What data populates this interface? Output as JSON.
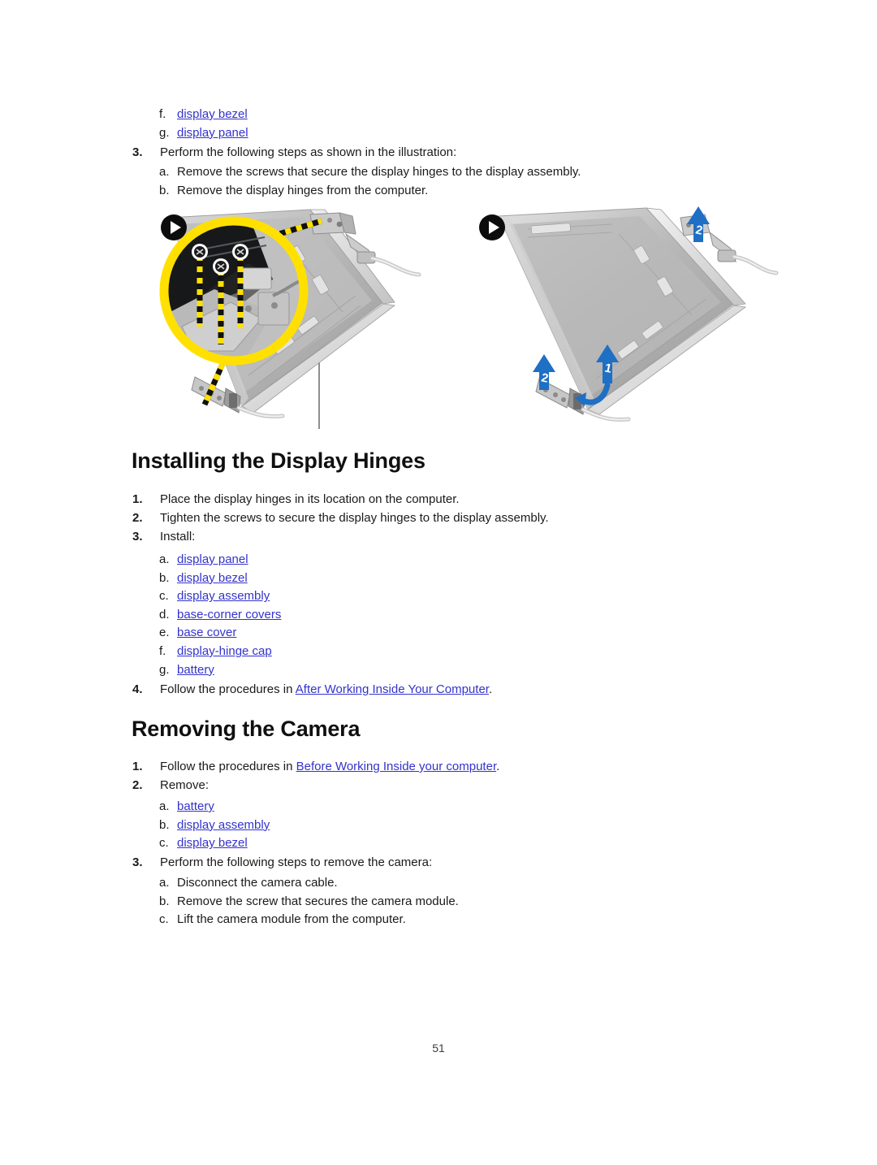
{
  "page": {
    "number": "51",
    "link_color": "#3333cc",
    "text_color": "#1a1a1a"
  },
  "continued_list": {
    "items": [
      {
        "marker": "f.",
        "label": "display bezel",
        "is_link": true
      },
      {
        "marker": "g.",
        "label": "display panel",
        "is_link": true
      }
    ]
  },
  "step3_top": {
    "marker": "3.",
    "text": "Perform the following steps as shown in the illustration:",
    "substeps": [
      {
        "marker": "a.",
        "text": "Remove the screws that secure the display hinges to the display assembly."
      },
      {
        "marker": "b.",
        "text": "Remove the display hinges from the computer."
      }
    ]
  },
  "figure": {
    "name": "display-hinge-removal-illustration",
    "left_panel": {
      "badge": "play-icon",
      "magnifier_color": "#ffe000",
      "callout_line_colors": [
        "#ffe000",
        "#111111"
      ],
      "screw_count": 3
    },
    "right_panel": {
      "badge": "play-icon",
      "arrow_color": "#1f6fc4",
      "arrow_labels": [
        "1",
        "2",
        "2"
      ]
    }
  },
  "section_installing": {
    "heading": "Installing the Display Hinges",
    "steps": [
      {
        "marker": "1.",
        "text": "Place the display hinges in its location on the computer."
      },
      {
        "marker": "2.",
        "text": "Tighten the screws to secure the display hinges to the display assembly."
      },
      {
        "marker": "3.",
        "text": "Install:"
      }
    ],
    "install_items": [
      {
        "marker": "a.",
        "label": "display panel"
      },
      {
        "marker": "b.",
        "label": "display bezel"
      },
      {
        "marker": "c.",
        "label": "display assembly"
      },
      {
        "marker": "d.",
        "label": "base-corner covers"
      },
      {
        "marker": "e.",
        "label": "base cover"
      },
      {
        "marker": "f.",
        "label": "display-hinge cap"
      },
      {
        "marker": "g.",
        "label": "battery"
      }
    ],
    "step4": {
      "marker": "4.",
      "prefix": "Follow the procedures in ",
      "link": "After Working Inside Your Computer",
      "suffix": "."
    }
  },
  "section_removing_camera": {
    "heading": "Removing the Camera",
    "step1": {
      "marker": "1.",
      "prefix": "Follow the procedures in ",
      "link": "Before Working Inside your computer",
      "suffix": "."
    },
    "step2": {
      "marker": "2.",
      "text": "Remove:"
    },
    "remove_items": [
      {
        "marker": "a.",
        "label": "battery"
      },
      {
        "marker": "b.",
        "label": "display assembly"
      },
      {
        "marker": "c.",
        "label": "display bezel"
      }
    ],
    "step3": {
      "marker": "3.",
      "text": "Perform the following steps to remove the camera:",
      "substeps": [
        {
          "marker": "a.",
          "text": "Disconnect the camera cable."
        },
        {
          "marker": "b.",
          "text": "Remove the screw that secures the camera module."
        },
        {
          "marker": "c.",
          "text": "Lift the camera module from the computer."
        }
      ]
    }
  }
}
